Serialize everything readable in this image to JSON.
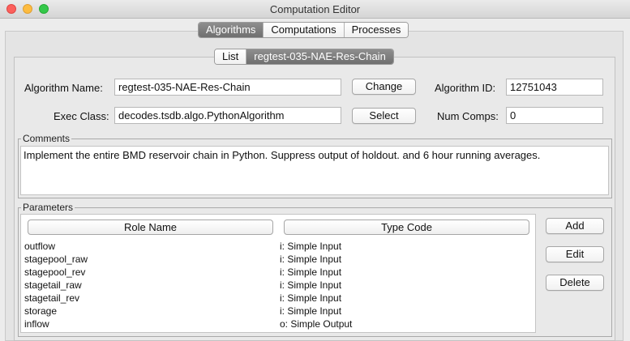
{
  "window": {
    "title": "Computation Editor"
  },
  "top_tabs": [
    "Algorithms",
    "Computations",
    "Processes"
  ],
  "top_tabs_selected": "Algorithms",
  "sub_tabs": [
    "List",
    "regtest-035-NAE-Res-Chain"
  ],
  "sub_tabs_selected": "regtest-035-NAE-Res-Chain",
  "form": {
    "algorithm_name_label": "Algorithm Name:",
    "algorithm_name_value": "regtest-035-NAE-Res-Chain",
    "change_button": "Change",
    "algorithm_id_label": "Algorithm ID:",
    "algorithm_id_value": "12751043",
    "exec_class_label": "Exec Class:",
    "exec_class_value": "decodes.tsdb.algo.PythonAlgorithm",
    "select_button": "Select",
    "num_comps_label": "Num Comps:",
    "num_comps_value": "0"
  },
  "comments": {
    "title": "Comments",
    "text": "Implement the entire BMD reservoir chain in Python. Suppress output of holdout. and 6 hour running averages."
  },
  "parameters": {
    "title": "Parameters",
    "columns": [
      "Role Name",
      "Type Code"
    ],
    "rows": [
      {
        "role": "outflow",
        "type": "i: Simple Input"
      },
      {
        "role": "stagepool_raw",
        "type": "i: Simple Input"
      },
      {
        "role": "stagepool_rev",
        "type": "i: Simple Input"
      },
      {
        "role": "stagetail_raw",
        "type": "i: Simple Input"
      },
      {
        "role": "stagetail_rev",
        "type": "i: Simple Input"
      },
      {
        "role": "storage",
        "type": "i: Simple Input"
      },
      {
        "role": "inflow",
        "type": "o: Simple Output"
      }
    ],
    "add_button": "Add",
    "edit_button": "Edit",
    "delete_button": "Delete"
  }
}
